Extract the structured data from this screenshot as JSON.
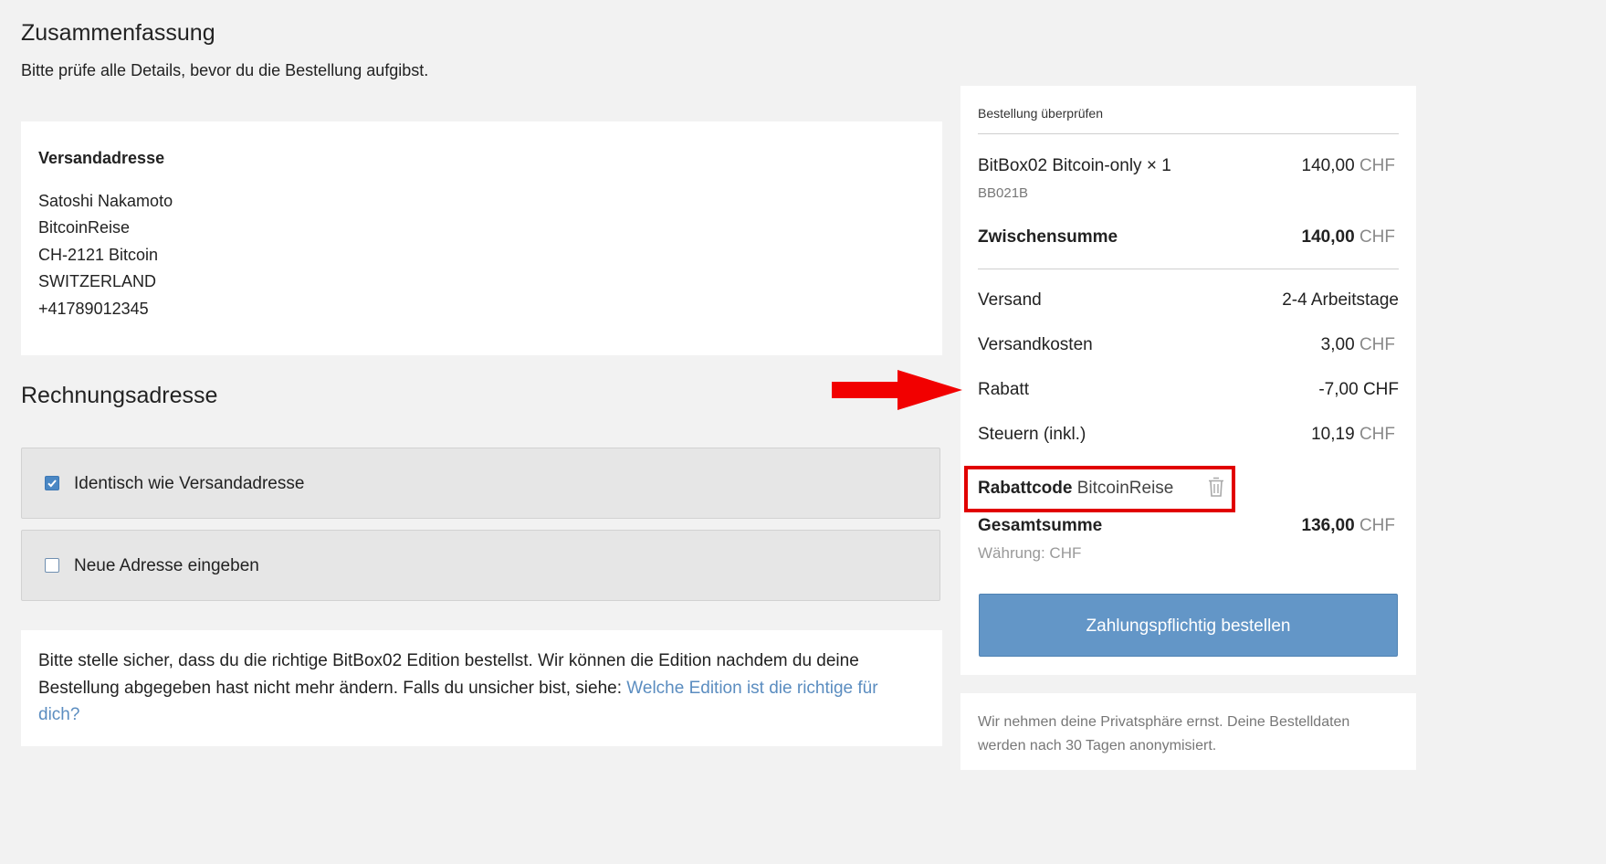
{
  "summary": {
    "title": "Zusammenfassung",
    "subtitle": "Bitte prüfe alle Details, bevor du die Bestellung aufgibst."
  },
  "shipping": {
    "heading": "Versandadresse",
    "lines": [
      "Satoshi Nakamoto",
      "BitcoinReise",
      "CH-2121 Bitcoin",
      "SWITZERLAND",
      "+41789012345"
    ]
  },
  "billing": {
    "title": "Rechnungsadresse",
    "options": [
      {
        "label": "Identisch wie Versandadresse",
        "checked": true
      },
      {
        "label": "Neue Adresse eingeben",
        "checked": false
      }
    ]
  },
  "note": {
    "text": "Bitte stelle sicher, dass du die richtige BitBox02 Edition bestellst. Wir können die Edition nachdem du deine Bestellung abgegeben hast nicht mehr ändern. Falls du unsicher bist, siehe: ",
    "link": "Welche Edition ist die richtige für dich?"
  },
  "order": {
    "review_title": "Bestellung überprüfen",
    "product": {
      "name": "BitBox02 Bitcoin-only × 1",
      "amount": "140,00",
      "currency": "CHF",
      "sku": "BB021B"
    },
    "subtotal": {
      "label": "Zwischensumme",
      "amount": "140,00",
      "currency": "CHF"
    },
    "shipping": {
      "label": "Versand",
      "value": "2-4 Arbeitstage"
    },
    "shipping_cost": {
      "label": "Versandkosten",
      "amount": "3,00",
      "currency": "CHF"
    },
    "discount": {
      "label": "Rabatt",
      "value": "-7,00 CHF"
    },
    "tax": {
      "label": "Steuern (inkl.)",
      "amount": "10,19",
      "currency": "CHF"
    },
    "coupon": {
      "label": "Rabattcode",
      "code": "BitcoinReise"
    },
    "total": {
      "label": "Gesamtsumme",
      "amount": "136,00",
      "currency": "CHF"
    },
    "currency_note": "Währung: CHF",
    "submit_label": "Zahlungspflichtig bestellen"
  },
  "privacy": {
    "text": "Wir nehmen deine Privatsphäre ernst. Deine Bestelldaten werden nach 30 Tagen anonymisiert."
  },
  "colors": {
    "accent": "#6396c7",
    "link": "#5b8dc0",
    "highlight": "#e10000",
    "background": "#f2f2f2"
  }
}
